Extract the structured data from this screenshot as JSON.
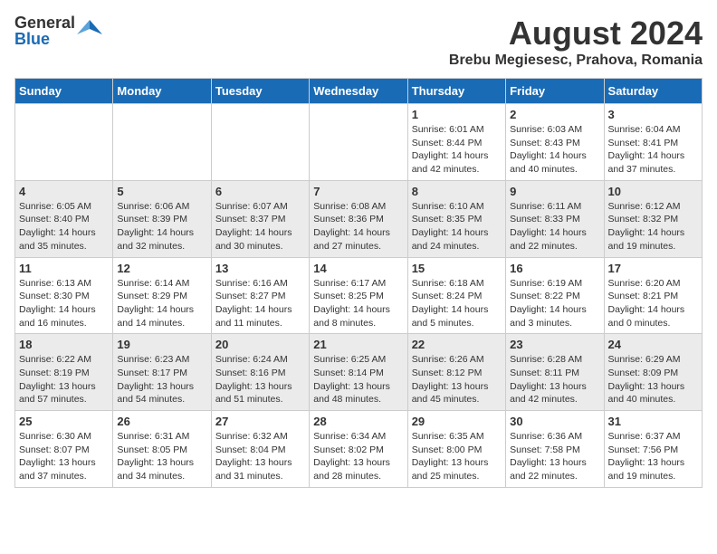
{
  "header": {
    "logo_general": "General",
    "logo_blue": "Blue",
    "title": "August 2024",
    "subtitle": "Brebu Megiesesc, Prahova, Romania"
  },
  "days_of_week": [
    "Sunday",
    "Monday",
    "Tuesday",
    "Wednesday",
    "Thursday",
    "Friday",
    "Saturday"
  ],
  "weeks": [
    [
      {
        "day": "",
        "info": ""
      },
      {
        "day": "",
        "info": ""
      },
      {
        "day": "",
        "info": ""
      },
      {
        "day": "",
        "info": ""
      },
      {
        "day": "1",
        "info": "Sunrise: 6:01 AM\nSunset: 8:44 PM\nDaylight: 14 hours and 42 minutes."
      },
      {
        "day": "2",
        "info": "Sunrise: 6:03 AM\nSunset: 8:43 PM\nDaylight: 14 hours and 40 minutes."
      },
      {
        "day": "3",
        "info": "Sunrise: 6:04 AM\nSunset: 8:41 PM\nDaylight: 14 hours and 37 minutes."
      }
    ],
    [
      {
        "day": "4",
        "info": "Sunrise: 6:05 AM\nSunset: 8:40 PM\nDaylight: 14 hours and 35 minutes."
      },
      {
        "day": "5",
        "info": "Sunrise: 6:06 AM\nSunset: 8:39 PM\nDaylight: 14 hours and 32 minutes."
      },
      {
        "day": "6",
        "info": "Sunrise: 6:07 AM\nSunset: 8:37 PM\nDaylight: 14 hours and 30 minutes."
      },
      {
        "day": "7",
        "info": "Sunrise: 6:08 AM\nSunset: 8:36 PM\nDaylight: 14 hours and 27 minutes."
      },
      {
        "day": "8",
        "info": "Sunrise: 6:10 AM\nSunset: 8:35 PM\nDaylight: 14 hours and 24 minutes."
      },
      {
        "day": "9",
        "info": "Sunrise: 6:11 AM\nSunset: 8:33 PM\nDaylight: 14 hours and 22 minutes."
      },
      {
        "day": "10",
        "info": "Sunrise: 6:12 AM\nSunset: 8:32 PM\nDaylight: 14 hours and 19 minutes."
      }
    ],
    [
      {
        "day": "11",
        "info": "Sunrise: 6:13 AM\nSunset: 8:30 PM\nDaylight: 14 hours and 16 minutes."
      },
      {
        "day": "12",
        "info": "Sunrise: 6:14 AM\nSunset: 8:29 PM\nDaylight: 14 hours and 14 minutes."
      },
      {
        "day": "13",
        "info": "Sunrise: 6:16 AM\nSunset: 8:27 PM\nDaylight: 14 hours and 11 minutes."
      },
      {
        "day": "14",
        "info": "Sunrise: 6:17 AM\nSunset: 8:25 PM\nDaylight: 14 hours and 8 minutes."
      },
      {
        "day": "15",
        "info": "Sunrise: 6:18 AM\nSunset: 8:24 PM\nDaylight: 14 hours and 5 minutes."
      },
      {
        "day": "16",
        "info": "Sunrise: 6:19 AM\nSunset: 8:22 PM\nDaylight: 14 hours and 3 minutes."
      },
      {
        "day": "17",
        "info": "Sunrise: 6:20 AM\nSunset: 8:21 PM\nDaylight: 14 hours and 0 minutes."
      }
    ],
    [
      {
        "day": "18",
        "info": "Sunrise: 6:22 AM\nSunset: 8:19 PM\nDaylight: 13 hours and 57 minutes."
      },
      {
        "day": "19",
        "info": "Sunrise: 6:23 AM\nSunset: 8:17 PM\nDaylight: 13 hours and 54 minutes."
      },
      {
        "day": "20",
        "info": "Sunrise: 6:24 AM\nSunset: 8:16 PM\nDaylight: 13 hours and 51 minutes."
      },
      {
        "day": "21",
        "info": "Sunrise: 6:25 AM\nSunset: 8:14 PM\nDaylight: 13 hours and 48 minutes."
      },
      {
        "day": "22",
        "info": "Sunrise: 6:26 AM\nSunset: 8:12 PM\nDaylight: 13 hours and 45 minutes."
      },
      {
        "day": "23",
        "info": "Sunrise: 6:28 AM\nSunset: 8:11 PM\nDaylight: 13 hours and 42 minutes."
      },
      {
        "day": "24",
        "info": "Sunrise: 6:29 AM\nSunset: 8:09 PM\nDaylight: 13 hours and 40 minutes."
      }
    ],
    [
      {
        "day": "25",
        "info": "Sunrise: 6:30 AM\nSunset: 8:07 PM\nDaylight: 13 hours and 37 minutes."
      },
      {
        "day": "26",
        "info": "Sunrise: 6:31 AM\nSunset: 8:05 PM\nDaylight: 13 hours and 34 minutes."
      },
      {
        "day": "27",
        "info": "Sunrise: 6:32 AM\nSunset: 8:04 PM\nDaylight: 13 hours and 31 minutes."
      },
      {
        "day": "28",
        "info": "Sunrise: 6:34 AM\nSunset: 8:02 PM\nDaylight: 13 hours and 28 minutes."
      },
      {
        "day": "29",
        "info": "Sunrise: 6:35 AM\nSunset: 8:00 PM\nDaylight: 13 hours and 25 minutes."
      },
      {
        "day": "30",
        "info": "Sunrise: 6:36 AM\nSunset: 7:58 PM\nDaylight: 13 hours and 22 minutes."
      },
      {
        "day": "31",
        "info": "Sunrise: 6:37 AM\nSunset: 7:56 PM\nDaylight: 13 hours and 19 minutes."
      }
    ]
  ]
}
